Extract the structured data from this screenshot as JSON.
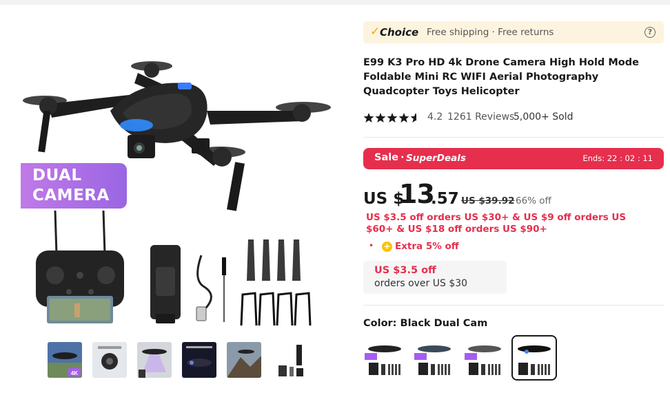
{
  "gallery": {
    "badge_line1": "DUAL",
    "badge_line2": "CAMERA",
    "thumbnail_badge": "4K",
    "thumbnail_count": 6,
    "thumbnail_colors": [
      "#5b7bb0",
      "#d7dbe0",
      "#c9cfd6",
      "#1c1c2e",
      "#7a6a5a",
      "#eef1f4"
    ]
  },
  "choice_bar": {
    "brand": "Choice",
    "shipping": "Free shipping · Free returns",
    "help_icon": "question-circle-icon"
  },
  "product": {
    "title": "E99 K3 Pro HD 4k Drone Camera High Hold Mode Foldable Mini RC WIFI Aerial Photography Quadcopter Toys Helicopter",
    "rating": "4.2",
    "stars_value": 4.2,
    "reviews": "1261 Reviews",
    "sold": "5,000+ Sold"
  },
  "sale": {
    "label": "Sale",
    "separator": "·",
    "program": "SuperDeals",
    "ends": "Ends: 22 : 02 : 11"
  },
  "price": {
    "currency": "US $",
    "integer": "13",
    "decimal": ".57",
    "original": "US $39.92",
    "discount": "66% off"
  },
  "coupons": {
    "tiers": "US $3.5 off orders US $30+ & US $9 off orders US $60+ & US $18 off orders US $90+",
    "extra_bullet": "•",
    "extra_icon": "plus-coin-icon",
    "extra": "Extra 5% off",
    "box_amount": "US $3.5 off",
    "box_condition": "orders over US $30"
  },
  "color": {
    "label": "Color: Black Dual Cam",
    "options_count": 4,
    "selected_index": 3
  },
  "colors": {
    "accent_red": "#e62e4d",
    "choice_bg": "#fdf4df",
    "choice_gold": "#f0a800",
    "badge_purple": "#9a66e3"
  }
}
